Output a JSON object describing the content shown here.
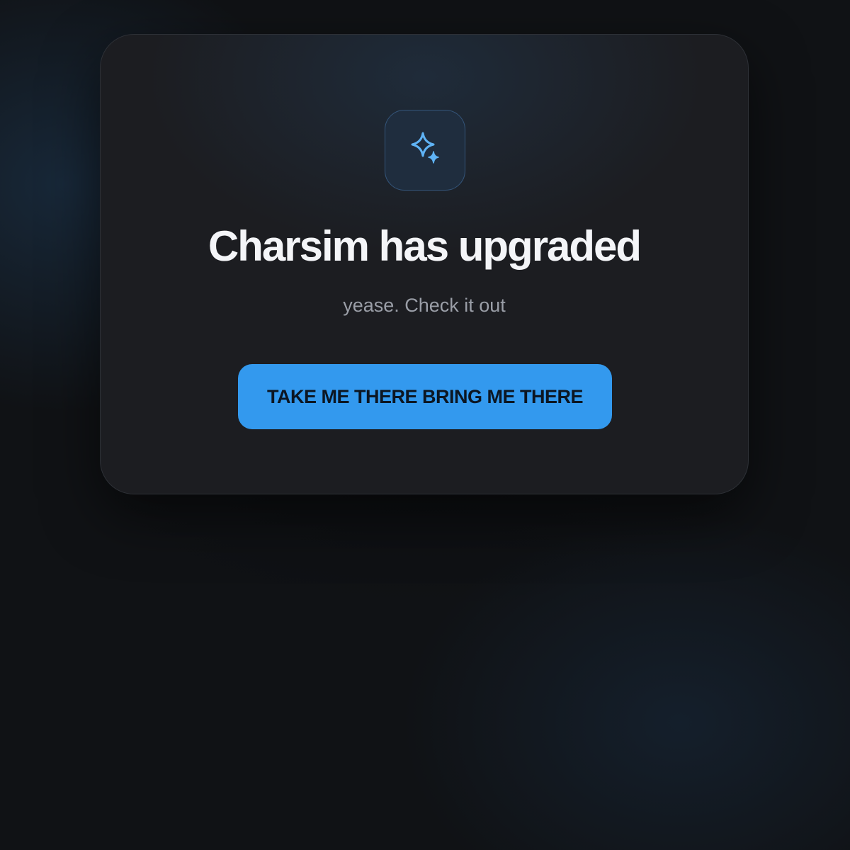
{
  "dialog": {
    "icon": "sparkles-icon",
    "title": "Charsim has upgraded",
    "subtitle": "yease. Check it out",
    "cta_label": "TAKE ME THERE BRING ME THERE"
  },
  "colors": {
    "accent": "#3399ee",
    "icon_color": "#5fb3f5",
    "background": "#101215",
    "card": "#1c1d21",
    "title_text": "#f4f5f8",
    "subtitle_text": "#9a9ea7",
    "button_text": "#0c1622"
  }
}
